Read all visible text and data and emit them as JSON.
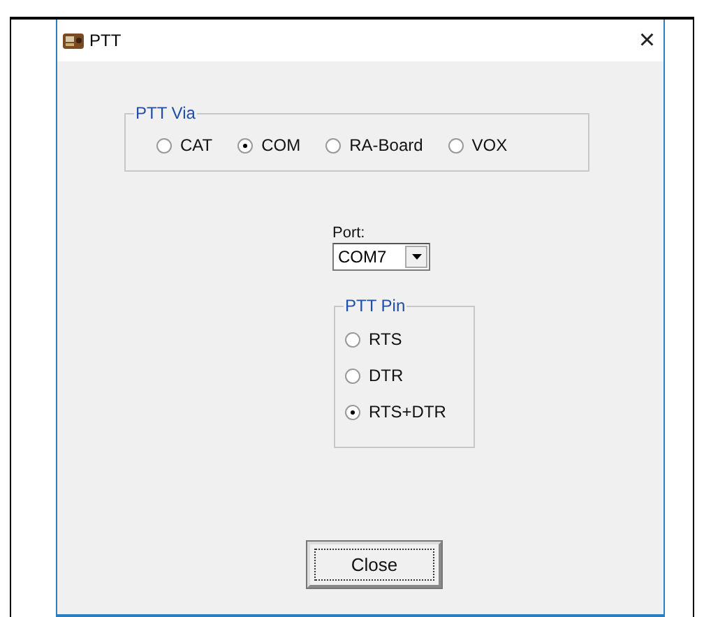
{
  "window": {
    "title": "PTT",
    "close": "×"
  },
  "ptt_via": {
    "label": "PTT Via",
    "options": [
      {
        "label": "CAT",
        "selected": false
      },
      {
        "label": "COM",
        "selected": true
      },
      {
        "label": "RA-Board",
        "selected": false
      },
      {
        "label": "VOX",
        "selected": false
      }
    ]
  },
  "port": {
    "label": "Port:",
    "value": "COM7"
  },
  "ptt_pin": {
    "label": "PTT Pin",
    "options": [
      {
        "label": "RTS",
        "selected": false
      },
      {
        "label": "DTR",
        "selected": false
      },
      {
        "label": "RTS+DTR",
        "selected": true
      }
    ]
  },
  "buttons": [
    {
      "label": "Close"
    }
  ]
}
